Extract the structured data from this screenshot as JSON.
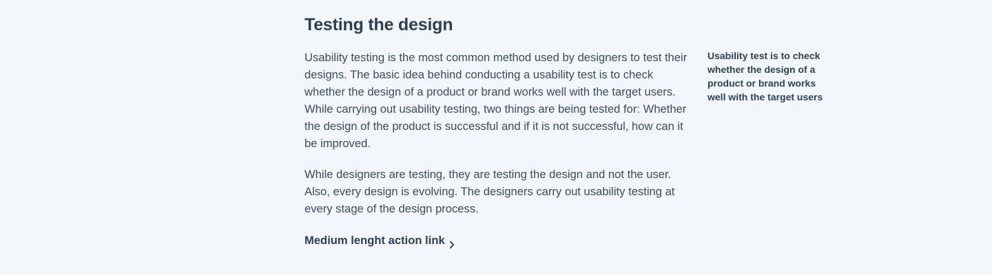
{
  "article": {
    "title": "Testing the design",
    "paragraph_1": "Usability testing is the most common method used by designers to test their designs. The basic idea behind conducting a usability test is to check whether the design of a product or brand works well with the target users. While carrying out usability testing, two things are being tested for: Whether the design of the product is successful and if it is not successful, how can it be improved.",
    "paragraph_2": "While designers are testing, they are testing the design and not the user. Also, every design is evolving. The designers carry out usability testing at every stage of the design process.",
    "action_link_label": "Medium lenght action link",
    "action_link_icon": "chevron-right-icon"
  },
  "aside": {
    "pullquote": "Usability test is to check whether the design of a product or brand works well with the target users"
  },
  "colors": {
    "background": "#f3f7fb",
    "heading": "#2d3f53",
    "body_text": "#3b4a5b"
  }
}
